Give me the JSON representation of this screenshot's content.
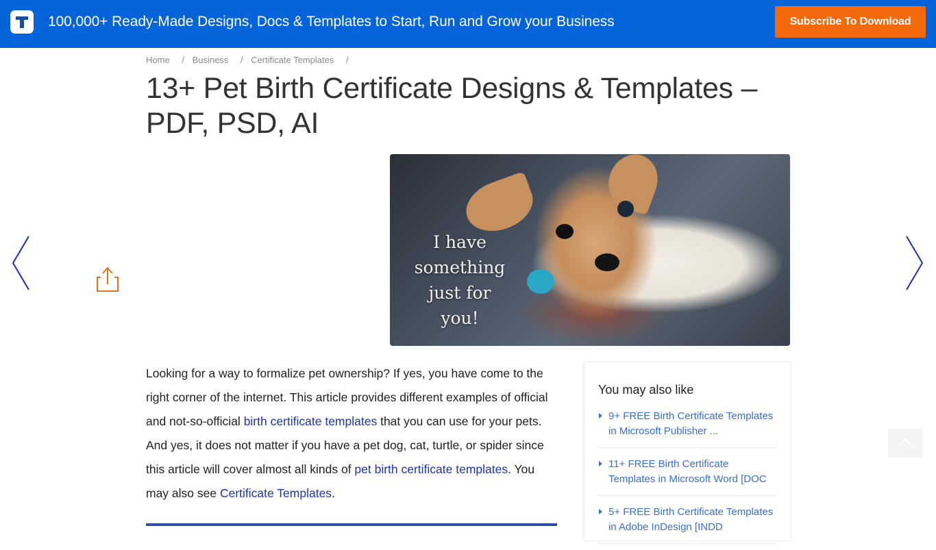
{
  "topbar": {
    "logo_icon": "template-t-logo-icon",
    "tagline": "100,000+ Ready-Made Designs, Docs & Templates to Start, Run and Grow your Business",
    "subscribe_label": "Subscribe To Download",
    "colors": {
      "bar": "#0664db",
      "button": "#f4690b"
    }
  },
  "breadcrumb": {
    "items": [
      "Home",
      "Business",
      "Certificate Templates"
    ],
    "separator": "/"
  },
  "article": {
    "title": "13+ Pet Birth Certificate Designs & Templates – PDF, PSD, AI",
    "hero": {
      "description": "Chihuahua puppy holding a slipper in its mouth",
      "caption_lines": [
        "I have",
        "something",
        "just for",
        "you!"
      ]
    },
    "intro": {
      "part1": "Looking for a way to formalize pet ownership? If yes, you have come to the right corner of the internet. This article provides different examples of official and not-so-official ",
      "link1": "birth certificate templates",
      "part2": " that you can use for your pets. And yes, it does not matter if you have a pet dog, cat, turtle, or spider since this article will cover almost all kinds of ",
      "link2": "pet birth certificate templates",
      "part3": ". You may also see ",
      "link3": "Certificate Templates",
      "part4": "."
    }
  },
  "navigation": {
    "prev_icon": "chevron-left-icon",
    "next_icon": "chevron-right-icon",
    "share_icon": "share-icon",
    "scroll_top_icon": "chevron-up-icon"
  },
  "sidebar": {
    "title": "You may also like",
    "items": [
      {
        "label": "9+ FREE Birth Certificate Templates in Microsoft Publisher ..."
      },
      {
        "label": "11+ FREE Birth Certificate Templates in Microsoft Word [DOC"
      },
      {
        "label": "5+ FREE Birth Certificate Templates in Adobe InDesign [INDD"
      }
    ]
  }
}
